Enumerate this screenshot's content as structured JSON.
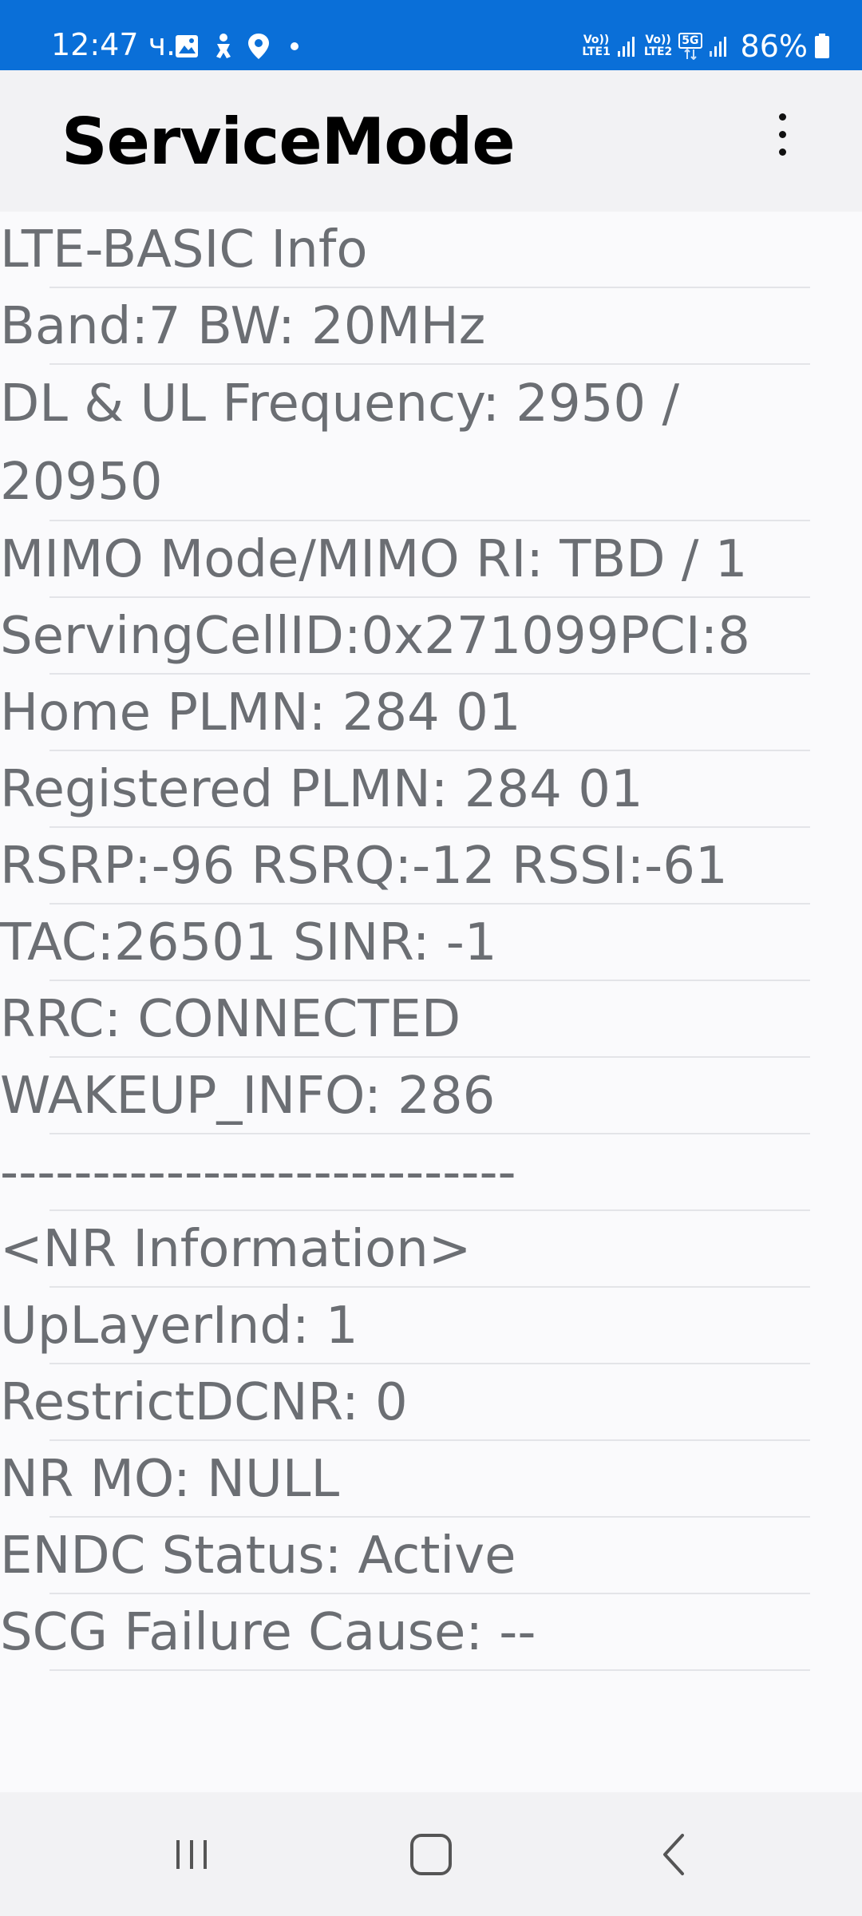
{
  "status_bar": {
    "time": "12:47 ч.",
    "sim1_label": "Vo))\nLTE1",
    "sim2_label": "Vo))\nLTE2",
    "network_type": "5G",
    "battery": "86%",
    "icons": [
      "gallery-icon",
      "accessibility-icon",
      "location-icon",
      "notification-dot-icon",
      "signal-icon",
      "signal-icon",
      "battery-icon"
    ]
  },
  "app_bar": {
    "title": "ServiceMode",
    "menu_icon": "more-vert-icon"
  },
  "info_lines": [
    "LTE-BASIC Info",
    "Band:7 BW: 20MHz",
    "DL & UL Frequency: 2950 / 20950",
    "MIMO Mode/MIMO RI: TBD / 1",
    "ServingCellID:0x271099PCI:8",
    "Home PLMN: 284 01",
    "Registered PLMN: 284 01",
    "RSRP:-96 RSRQ:-12 RSSI:-61",
    "TAC:26501 SINR: -1",
    "RRC: CONNECTED",
    "WAKEUP_INFO: 286",
    "----------------------------",
    "<NR Information>",
    "UpLayerInd: 1",
    "RestrictDCNR: 0",
    "NR MO: NULL",
    "ENDC Status: Active",
    "SCG Failure Cause: --"
  ],
  "nav_bar": {
    "buttons": [
      "recents-icon",
      "home-icon",
      "back-icon"
    ]
  },
  "colors": {
    "status_bar": "#0a6fd8",
    "app_bar": "#f2f2f4",
    "content_bg": "#fafafc",
    "text": "#6b6e73"
  }
}
